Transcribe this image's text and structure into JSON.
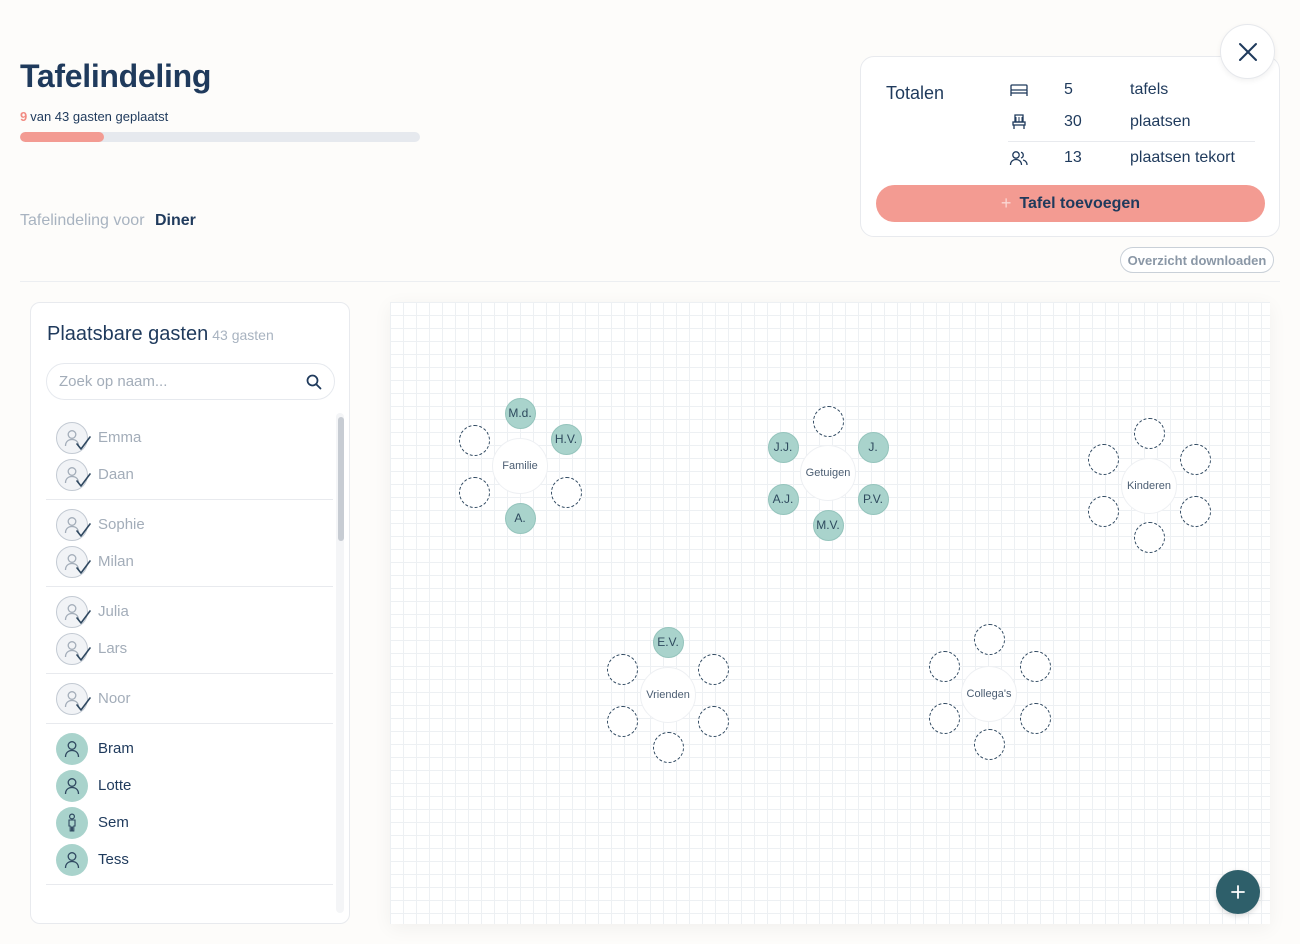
{
  "header": {
    "title": "Tafelindeling",
    "placed_count": "9",
    "placed_text": "van 43 gasten geplaatst",
    "progress_fraction": 0.21,
    "subtitle_label": "Tafelindeling voor",
    "subtitle_value": "Diner"
  },
  "totals": {
    "title": "Totalen",
    "rows": [
      {
        "icon": "bed-table-icon",
        "value": "5",
        "label": "tafels"
      },
      {
        "icon": "chair-icon",
        "value": "30",
        "label": "plaatsen"
      },
      {
        "icon": "people-icon",
        "value": "13",
        "label": "plaatsen tekort"
      }
    ],
    "add_button_label": "Tafel toevoegen"
  },
  "download_label": "Overzicht downloaden",
  "guest_panel": {
    "title": "Plaatsbare gasten",
    "count": "43 gasten",
    "search_placeholder": "Zoek op naam...",
    "groups": [
      [
        {
          "name": "Emma",
          "placed": true
        },
        {
          "name": "Daan",
          "placed": true
        }
      ],
      [
        {
          "name": "Sophie",
          "placed": true
        },
        {
          "name": "Milan",
          "placed": true
        }
      ],
      [
        {
          "name": "Julia",
          "placed": true
        },
        {
          "name": "Lars",
          "placed": true
        }
      ],
      [
        {
          "name": "Noor",
          "placed": true
        }
      ],
      [
        {
          "name": "Bram",
          "placed": false,
          "icon": "person-icon"
        },
        {
          "name": "Lotte",
          "placed": false,
          "icon": "person-icon"
        },
        {
          "name": "Sem",
          "placed": false,
          "icon": "child-icon"
        },
        {
          "name": "Tess",
          "placed": false,
          "icon": "person-icon"
        }
      ]
    ]
  },
  "tables": [
    {
      "name": "Familie",
      "seats": [
        "M.d.",
        "H.V.",
        "",
        "A.",
        "",
        ""
      ]
    },
    {
      "name": "Getuigen",
      "seats": [
        "",
        "J.",
        "P.V.",
        "M.V.",
        "A.J.",
        "J.J."
      ]
    },
    {
      "name": "Kinderen",
      "seats": [
        "",
        "",
        "",
        "",
        "",
        ""
      ]
    },
    {
      "name": "Vrienden",
      "seats": [
        "E.V.",
        "",
        "",
        "",
        "",
        ""
      ]
    },
    {
      "name": "Collega's",
      "seats": [
        "",
        "",
        "",
        "",
        "",
        ""
      ]
    }
  ],
  "colors": {
    "accent": "#f39b92",
    "navy": "#1f3a5c",
    "seat_filled": "#a9d3cc",
    "fab": "#2e5f6a"
  }
}
